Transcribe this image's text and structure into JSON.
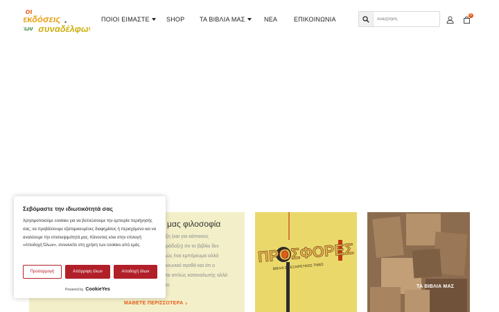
{
  "header": {
    "logo_text": "οι εκδόσεις των συναδέλφων",
    "nav": [
      {
        "label": "ΠΟΙΟΙ ΕΙΜΑΣΤΕ",
        "has_dropdown": true
      },
      {
        "label": "SHOP",
        "has_dropdown": false
      },
      {
        "label": "ΤΑ ΒΙΒΛΙΑ ΜΑΣ",
        "has_dropdown": true
      },
      {
        "label": "ΝΕΑ",
        "has_dropdown": false
      },
      {
        "label": "ΕΠΙΚΟΙΝΩΝΙΑ",
        "has_dropdown": false
      }
    ],
    "search": {
      "placeholder": "Αναζήτηση",
      "value": "",
      "icon": "search-icon"
    },
    "user_icon": "user-icon",
    "cart": {
      "icon": "shopping-bag-icon",
      "count": "0"
    }
  },
  "philosophy": {
    "title": "μας φιλοσοφία",
    "lines": [
      "όξη (και για κάποιους",
      "αράδοξη) ότι το βιβλίο δεν",
      "ιλώς ένα εμπόρευμα αλλά",
      "οινωνικό αγαθό και ότι ο",
      "ίναι απλώς καταναλωτής αλλά",
      "ιου."
    ],
    "more": "ΜΑΘΕΤΕ ΠΕΡΙΣΣΟΤΕΡΑ"
  },
  "offers": {
    "title": "ΠΡΟΣΦΟΡΕΣ",
    "subtitle": "ΒΙΒΛΙΑ ΣΕ ΕΞΑΙΡΕΤΙΚΕΣ ΤΙΜΕΣ"
  },
  "books": {
    "label": "ΤΑ ΒΙΒΛΙΑ ΜΑΣ"
  },
  "cookie": {
    "title": "Σεβόμαστε την ιδιωτικότητά σας",
    "text": "Χρησιμοποιούμε cookies για να βελτιώσουμε την εμπειρία περιήγησής σας, να προβάλλουμε εξατομικευμένες διαφημίσεις ή περιεχόμενο και να αναλύουμε την επισκεψιμότητά μας. Κάνοντας κλικ στην επιλογή «Αποδοχή Όλων», συναινείτε στη χρήση των cookies από εμάς.",
    "customize": "Προσαρμογή",
    "reject": "Απόρριψη όλων",
    "accept": "Αποδοχή όλων",
    "powered_by": "Powered by",
    "brand": "CookieYes"
  },
  "colors": {
    "accent": "#e85a17",
    "cookie_red": "#b11f29",
    "philo_bg": "#f3f0c9",
    "offers_bg": "#ead96a",
    "books_bg": "#8a6a4e"
  }
}
